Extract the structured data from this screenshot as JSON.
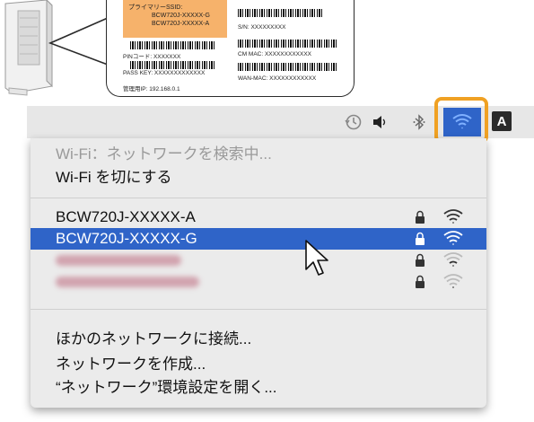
{
  "label": {
    "ssid_title": "プライマリーSSID:",
    "ssid_values": [
      "BCW720J-XXXXX-G",
      "BCW720J-XXXXX-A"
    ],
    "pin": "PINコード:   XXXXXXX",
    "passkey": "PASS KEY: XXXXXXXXXXXXX",
    "admin_ip": "管理用IP:    192.168.0.1",
    "serial": "S/N:        XXXXXXXXX",
    "cm_mac": "CM MAC:  XXXXXXXXXXXX",
    "wan_mac": "WAN-MAC: XXXXXXXXXXXX"
  },
  "menubar": {
    "icons": [
      "time-machine-icon",
      "volume-icon",
      "bluetooth-icon",
      "wifi-icon"
    ],
    "input_source": "A",
    "highlight_color": "#f0a123",
    "selection_color": "#2f64c8"
  },
  "menu": {
    "status": "Wi-Fi：ネットワークを検索中...",
    "toggle": "Wi-Fi を切にする",
    "networks": [
      {
        "name": "BCW720J-XXXXX-A",
        "locked": true,
        "selected": false,
        "obscured": false
      },
      {
        "name": "BCW720J-XXXXX-G",
        "locked": true,
        "selected": true,
        "obscured": false
      },
      {
        "name": "",
        "locked": true,
        "selected": false,
        "obscured": true
      },
      {
        "name": "",
        "locked": true,
        "selected": false,
        "obscured": true
      }
    ],
    "other_network": "ほかのネットワークに接続...",
    "create_network": "ネットワークを作成...",
    "open_prefs": "“ネットワーク”環境設定を開く..."
  }
}
